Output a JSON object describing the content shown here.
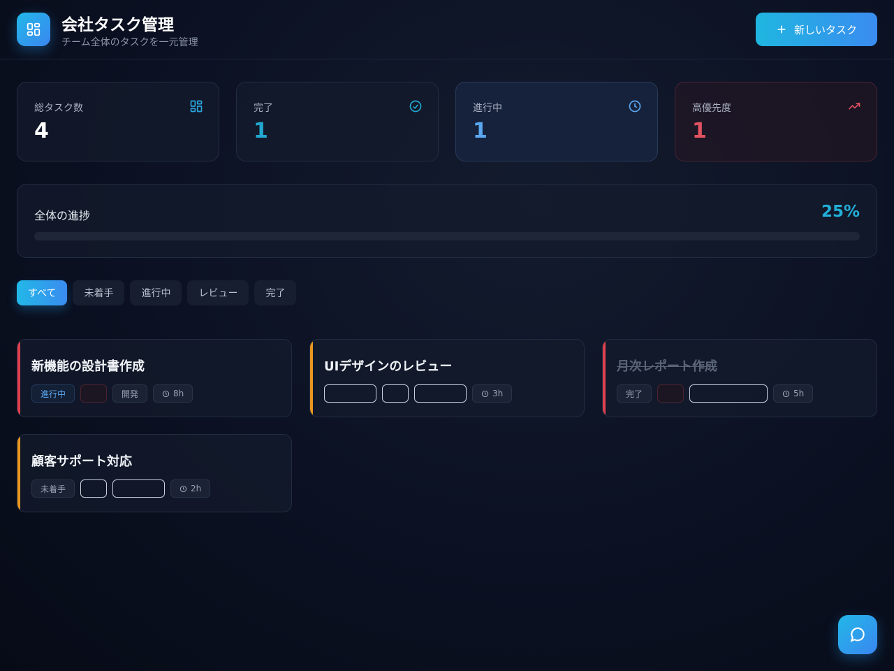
{
  "header": {
    "title": "会社タスク管理",
    "subtitle": "チーム全体のタスクを一元管理",
    "new_task_label": "新しいタスク",
    "logo_icon": "grid-icon"
  },
  "stats": [
    {
      "label": "総タスク数",
      "value": "4",
      "color": "#ffffff",
      "icon": "grid-icon"
    },
    {
      "label": "完了",
      "value": "1",
      "color": "#22a8d0",
      "icon": "check-circle-icon"
    },
    {
      "label": "進行中",
      "value": "1",
      "color": "#5aa7f0",
      "icon": "clock-icon"
    },
    {
      "label": "高優先度",
      "value": "1",
      "color": "#e05260",
      "icon": "trending-up-icon"
    }
  ],
  "progress": {
    "label": "全体の進捗",
    "value_text": "25%",
    "fraction": 0.25
  },
  "filters": {
    "active": "すべて",
    "tabs": [
      "すべて",
      "未着手",
      "進行中",
      "レビュー",
      "完了"
    ]
  },
  "tasks": [
    {
      "title": "新機能の設計書作成",
      "status": "進行中",
      "category": "開発",
      "hours": "8h",
      "accent": "#e0404e"
    },
    {
      "title": "UIデザインのレビュー",
      "hours": "3h",
      "accent": "#e8961e"
    },
    {
      "title": "月次レポート作成",
      "status": "完了",
      "hours": "5h",
      "accent": "#e0404e"
    },
    {
      "title": "顧客サポート対応",
      "status": "未着手",
      "hours": "2h",
      "accent": "#e8961e"
    }
  ],
  "colors": {
    "accent": "#22b8e8",
    "accent2": "#3a8cf0",
    "danger": "#e05260",
    "warning": "#e8961e"
  },
  "fab": {
    "icon": "chat-bubble-icon"
  }
}
